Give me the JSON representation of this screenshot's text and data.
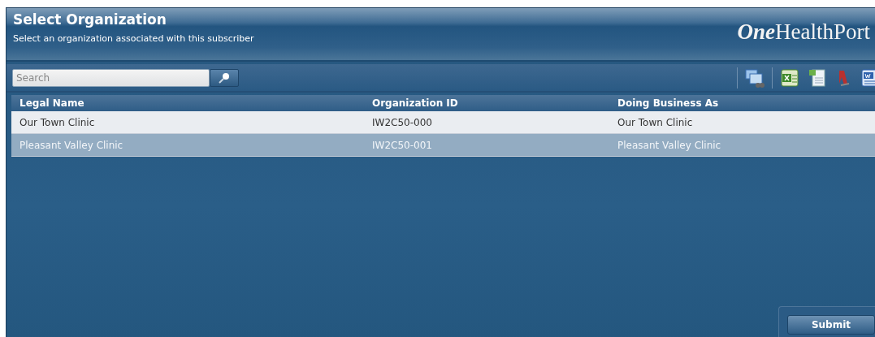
{
  "header": {
    "title": "Select Organization",
    "subtitle": "Select an organization associated with this subscriber",
    "logo_mark": "One",
    "logo_text": "HealthPort"
  },
  "search": {
    "placeholder": "Search"
  },
  "table": {
    "columns": [
      "Legal Name",
      "Organization ID",
      "Doing Business As"
    ],
    "rows": [
      {
        "cells": [
          "Our Town Clinic",
          "IW2C50-000",
          "Our Town Clinic"
        ],
        "selected": false
      },
      {
        "cells": [
          "Pleasant Valley Clinic",
          "IW2C50-001",
          "Pleasant Valley Clinic"
        ],
        "selected": true
      }
    ]
  },
  "buttons": [
    "Submit"
  ]
}
